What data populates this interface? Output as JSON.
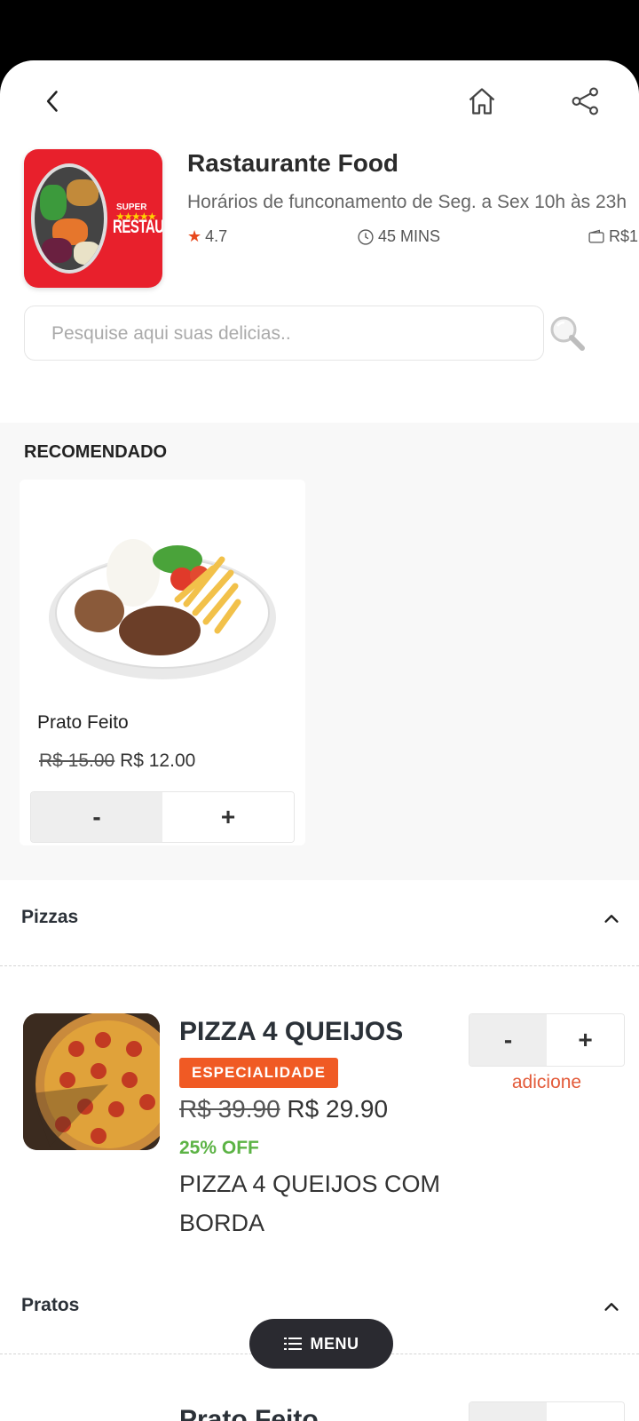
{
  "restaurant": {
    "name": "Rastaurante Food",
    "hours": "Horários de funconamento de Seg. a Sex 10h às 23h",
    "rating": "4.7",
    "delivery_time": "45 MINS",
    "min_price": "R$1",
    "logo": {
      "super": "SUPER",
      "stars": "★★★★★",
      "name": "RESTAURANTES"
    }
  },
  "search": {
    "placeholder": "Pesquise aqui suas delicias..",
    "value": ""
  },
  "recommended": {
    "title": "RECOMENDADO",
    "items": [
      {
        "name": "Prato Feito",
        "old_price": "R$ 15.00",
        "price": "R$ 12.00",
        "minus": "-",
        "plus": "+"
      }
    ]
  },
  "categories": [
    {
      "title": "Pizzas",
      "items": [
        {
          "name": "PIZZA 4 QUEIJOS",
          "badge": "ESPECIALIDADE",
          "old_price": "R$ 39.90",
          "price": "R$ 29.90",
          "discount": "25% OFF",
          "description": "PIZZA 4 QUEIJOS COM BORDA",
          "minus": "-",
          "plus": "+",
          "add_label": "adicione"
        }
      ]
    },
    {
      "title": "Pratos",
      "items": [
        {
          "name": "Prato Feito",
          "minus": "-",
          "plus": "+"
        }
      ]
    }
  ],
  "menu_button": {
    "label": "MENU",
    "icon": "list-icon"
  },
  "colors": {
    "accent": "#f05a24",
    "green": "#5cb345",
    "logo_red": "#e8202c",
    "menu_bg": "#2a2a30"
  }
}
